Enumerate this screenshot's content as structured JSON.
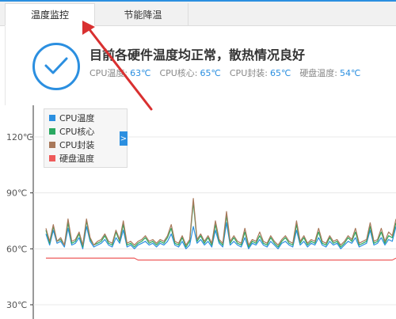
{
  "tabs": [
    {
      "label": "温度监控",
      "active": true
    },
    {
      "label": "节能降温",
      "active": false
    }
  ],
  "status": {
    "message": "目前各硬件温度均正常，散热情况良好",
    "readings": [
      {
        "label": "CPU温度:",
        "value": "63℃"
      },
      {
        "label": "CPU核心:",
        "value": "65℃"
      },
      {
        "label": "CPU封装:",
        "value": "65℃"
      },
      {
        "label": "硬盘温度:",
        "value": "54℃"
      }
    ]
  },
  "chart_data": {
    "type": "line",
    "y_ticks": [
      "120℃",
      "90℃",
      "60℃",
      "30℃"
    ],
    "y_tick_values": [
      120,
      90,
      60,
      30
    ],
    "ylim": [
      25,
      135
    ],
    "grid": true,
    "legend_position": "top-left",
    "series": [
      {
        "name": "CPU温度",
        "color": "#2b8fe0",
        "values": [
          68,
          62,
          70,
          63,
          64,
          61,
          71,
          62,
          63,
          66,
          60,
          72,
          64,
          61,
          62,
          63,
          65,
          62,
          61,
          66,
          63,
          70,
          61,
          62,
          60,
          62,
          63,
          64,
          62,
          63,
          61,
          63,
          62,
          64,
          68,
          62,
          61,
          64,
          60,
          62,
          72,
          63,
          65,
          62,
          64,
          61,
          70,
          63,
          61,
          74,
          62,
          64,
          62,
          61,
          66,
          60,
          63,
          62,
          65,
          62,
          61,
          64,
          62,
          60,
          63,
          64,
          62,
          61,
          70,
          62,
          64,
          61,
          63,
          62,
          66,
          62,
          61,
          64,
          62,
          63,
          60,
          62,
          64,
          63,
          66,
          61,
          62,
          63,
          70,
          62,
          63,
          66,
          62,
          65,
          64,
          72
        ]
      },
      {
        "name": "CPU核心",
        "color": "#2aa861",
        "values": [
          70,
          63,
          72,
          64,
          65,
          62,
          74,
          63,
          64,
          68,
          61,
          75,
          65,
          62,
          63,
          64,
          67,
          63,
          62,
          69,
          64,
          73,
          62,
          63,
          61,
          63,
          64,
          66,
          63,
          64,
          62,
          64,
          63,
          66,
          71,
          63,
          62,
          66,
          61,
          64,
          85,
          64,
          67,
          63,
          66,
          62,
          73,
          64,
          62,
          78,
          63,
          66,
          63,
          62,
          69,
          61,
          64,
          63,
          67,
          63,
          62,
          66,
          63,
          61,
          64,
          66,
          63,
          62,
          73,
          63,
          66,
          62,
          64,
          63,
          69,
          63,
          62,
          66,
          63,
          64,
          61,
          63,
          66,
          64,
          69,
          62,
          63,
          64,
          72,
          63,
          64,
          69,
          63,
          67,
          66,
          74
        ]
      },
      {
        "name": "CPU封装",
        "color": "#a8785a",
        "values": [
          71,
          64,
          73,
          64,
          66,
          62,
          76,
          64,
          65,
          69,
          62,
          76,
          66,
          62,
          64,
          65,
          68,
          64,
          63,
          70,
          65,
          75,
          63,
          64,
          62,
          64,
          65,
          67,
          64,
          65,
          63,
          65,
          64,
          67,
          73,
          64,
          63,
          67,
          62,
          65,
          87,
          65,
          68,
          64,
          67,
          63,
          75,
          65,
          63,
          80,
          64,
          67,
          64,
          63,
          71,
          62,
          65,
          64,
          69,
          64,
          63,
          67,
          64,
          62,
          65,
          67,
          64,
          63,
          75,
          64,
          67,
          63,
          65,
          64,
          71,
          64,
          63,
          67,
          64,
          65,
          62,
          64,
          67,
          65,
          71,
          63,
          64,
          65,
          74,
          64,
          65,
          71,
          64,
          69,
          67,
          76
        ]
      },
      {
        "name": "硬盘温度",
        "color": "#ee5a5a",
        "values": [
          55,
          55,
          55,
          55,
          55,
          55,
          55,
          55,
          55,
          55,
          55,
          55,
          55,
          55,
          55,
          55,
          55,
          55,
          55,
          55,
          55,
          55,
          55,
          55,
          55,
          54,
          54,
          54,
          54,
          54,
          54,
          54,
          54,
          54,
          54,
          54,
          54,
          54,
          54,
          54,
          54,
          54,
          54,
          54,
          54,
          54,
          54,
          54,
          54,
          54,
          54,
          54,
          54,
          54,
          54,
          54,
          54,
          54,
          54,
          54,
          54,
          54,
          54,
          54,
          54,
          54,
          54,
          54,
          54,
          54,
          54,
          54,
          54,
          54,
          54,
          54,
          54,
          54,
          54,
          54,
          54,
          54,
          54,
          54,
          54,
          54,
          54,
          54,
          54,
          54,
          54,
          54,
          54,
          54,
          54,
          55
        ]
      }
    ]
  }
}
